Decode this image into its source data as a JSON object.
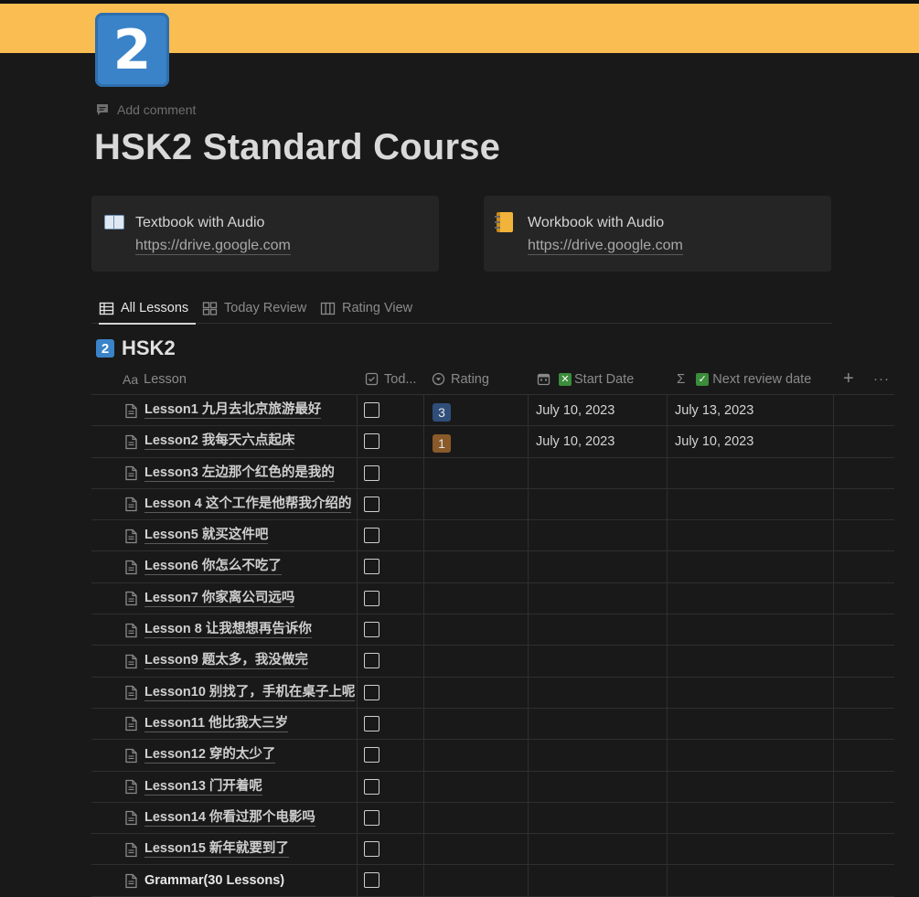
{
  "colors": {
    "cover": "#f9bd52",
    "background": "#191919",
    "rating_3": "#2f4f7a",
    "rating_1": "#8a5a2a",
    "check_badge": "#3b8c3b"
  },
  "page": {
    "icon_text": "2",
    "add_comment": "Add comment",
    "title": "HSK2 Standard Course"
  },
  "bookmarks": [
    {
      "icon": "open-book-icon",
      "title": "Textbook with Audio",
      "url": "https://drive.google.com"
    },
    {
      "icon": "notebook-icon",
      "title": "Workbook with Audio",
      "url": "https://drive.google.com"
    }
  ],
  "tabs": [
    {
      "label": "All Lessons",
      "icon": "table-icon",
      "active": true
    },
    {
      "label": "Today Review",
      "icon": "gallery-icon",
      "active": false
    },
    {
      "label": "Rating View",
      "icon": "board-icon",
      "active": false
    }
  ],
  "database": {
    "icon_text": "2",
    "title": "HSK2",
    "columns": {
      "lesson": "Lesson",
      "lesson_prefix": "Aa",
      "today": "Tod...",
      "rating": "Rating",
      "start_date": "Start Date",
      "start_prefix": "✕",
      "next_review": "Next review date",
      "next_prefix": "✓",
      "add": "+",
      "more": "···"
    },
    "rows": [
      {
        "lesson": "Lesson1 九月去北京旅游最好",
        "rating": "3",
        "start": "July 10, 2023",
        "next": "July 13, 2023"
      },
      {
        "lesson": "Lesson2 我每天六点起床",
        "rating": "1",
        "start": "July 10, 2023",
        "next": "July 10, 2023"
      },
      {
        "lesson": "Lesson3 左边那个红色的是我的",
        "rating": "",
        "start": "",
        "next": ""
      },
      {
        "lesson": "Lesson 4 这个工作是他帮我介绍的",
        "rating": "",
        "start": "",
        "next": ""
      },
      {
        "lesson": "Lesson5 就买这件吧",
        "rating": "",
        "start": "",
        "next": ""
      },
      {
        "lesson": "Lesson6 你怎么不吃了",
        "rating": "",
        "start": "",
        "next": ""
      },
      {
        "lesson": "Lesson7 你家离公司远吗",
        "rating": "",
        "start": "",
        "next": ""
      },
      {
        "lesson": "Lesson 8 让我想想再告诉你",
        "rating": "",
        "start": "",
        "next": ""
      },
      {
        "lesson": "Lesson9 题太多，我没做完",
        "rating": "",
        "start": "",
        "next": ""
      },
      {
        "lesson": "Lesson10 别找了，手机在桌子上呢",
        "rating": "",
        "start": "",
        "next": ""
      },
      {
        "lesson": "Lesson11 他比我大三岁",
        "rating": "",
        "start": "",
        "next": ""
      },
      {
        "lesson": "Lesson12 穿的太少了",
        "rating": "",
        "start": "",
        "next": ""
      },
      {
        "lesson": "Lesson13 门开着呢",
        "rating": "",
        "start": "",
        "next": ""
      },
      {
        "lesson": "Lesson14 你看过那个电影吗",
        "rating": "",
        "start": "",
        "next": ""
      },
      {
        "lesson": "Lesson15 新年就要到了",
        "rating": "",
        "start": "",
        "next": ""
      },
      {
        "lesson": "Grammar(30 Lessons)",
        "rating": "",
        "start": "",
        "next": ""
      }
    ]
  }
}
